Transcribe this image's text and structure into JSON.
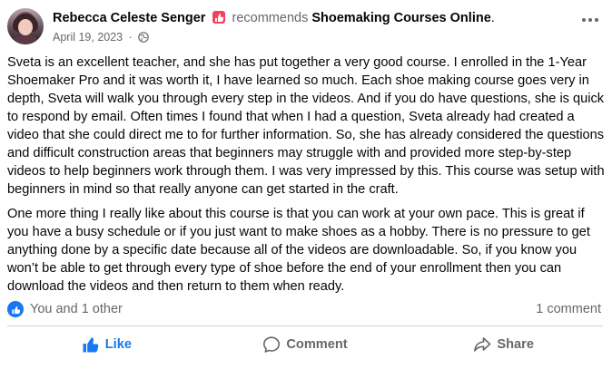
{
  "header": {
    "author": "Rebecca Celeste Senger",
    "recommends": "recommends",
    "page_name": "Shoemaking Courses Online",
    "dot": ".",
    "date": "April 19, 2023",
    "separator": "·"
  },
  "post": {
    "paragraphs": [
      "Sveta is an excellent teacher, and she has put together a very good course. I enrolled in the 1-Year Shoemaker Pro and it was worth it, I have learned so much. Each shoe making course goes very in depth, Sveta will walk you through every step in the videos. And if you do have questions, she is quick to respond by email. Often times I found that when I had a question, Sveta already had created a video that she could direct me to for further information. So, she has already considered the questions and difficult construction areas that beginners may struggle with and provided more step-by-step videos to help beginners work through them. I was very impressed by this. This course was setup with beginners in mind so that really anyone can get started in the craft.",
      "One more thing I really like about this course is that you can work at your own pace. This is great if you have a busy schedule or if you just want to make shoes as a hobby. There is no pressure to get anything done by a specific date because all of the videos are downloadable. So, if you know you won’t be able to get through every type of shoe before the end of your enrollment then you can download the videos and then return to them when ready."
    ]
  },
  "reactions": {
    "summary": "You and 1 other",
    "comments": "1 comment"
  },
  "actions": {
    "like": "Like",
    "comment": "Comment",
    "share": "Share"
  },
  "colors": {
    "accent": "#1877f2",
    "recommend_icon": "#f3425f",
    "secondary_text": "#65676b"
  },
  "icons": [
    "recommend-icon",
    "globe-icon",
    "more-icon",
    "like-badge-icon",
    "like-icon",
    "comment-icon",
    "share-icon"
  ]
}
